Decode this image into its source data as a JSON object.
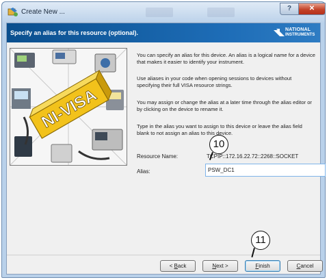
{
  "window": {
    "title": "Create New ...",
    "help_glyph": "?",
    "close_glyph": "✕"
  },
  "header": {
    "text": "Specify an alias for this resource (optional).",
    "logo_line1": "NATIONAL",
    "logo_line2": "INSTRUMENTS"
  },
  "image": {
    "label": "NI-VISA"
  },
  "description": [
    "You can specify an alias for this device. An alias is a logical name for a device that makes it easier to identify your instrument.",
    "Use aliases in your code when opening sessions to devices without specifying their full VISA resource strings.",
    "You may assign or change the alias at a later time through the alias editor or by clicking on the device to rename it.",
    "Type in the alias you want to assign to this device or leave the alias field blank to not assign an alias to this device."
  ],
  "form": {
    "resource_label": "Resource Name:",
    "resource_value": "TCPIP::172.16.22.72::2268::SOCKET",
    "alias_label": "Alias:",
    "alias_value": "PSW_DC1"
  },
  "buttons": {
    "back_underlined": "B",
    "back_rest": "ack",
    "back_prefix": "< ",
    "next_underlined": "N",
    "next_rest": "ext >",
    "finish_underlined": "F",
    "finish_rest": "inish",
    "cancel_underlined": "C",
    "cancel_rest": "ancel"
  },
  "callouts": {
    "c10": "10",
    "c11": "11"
  },
  "colors": {
    "header_blue": "#1e6db7",
    "close_red": "#c4442a",
    "logo_gold": "#f2c21b"
  }
}
